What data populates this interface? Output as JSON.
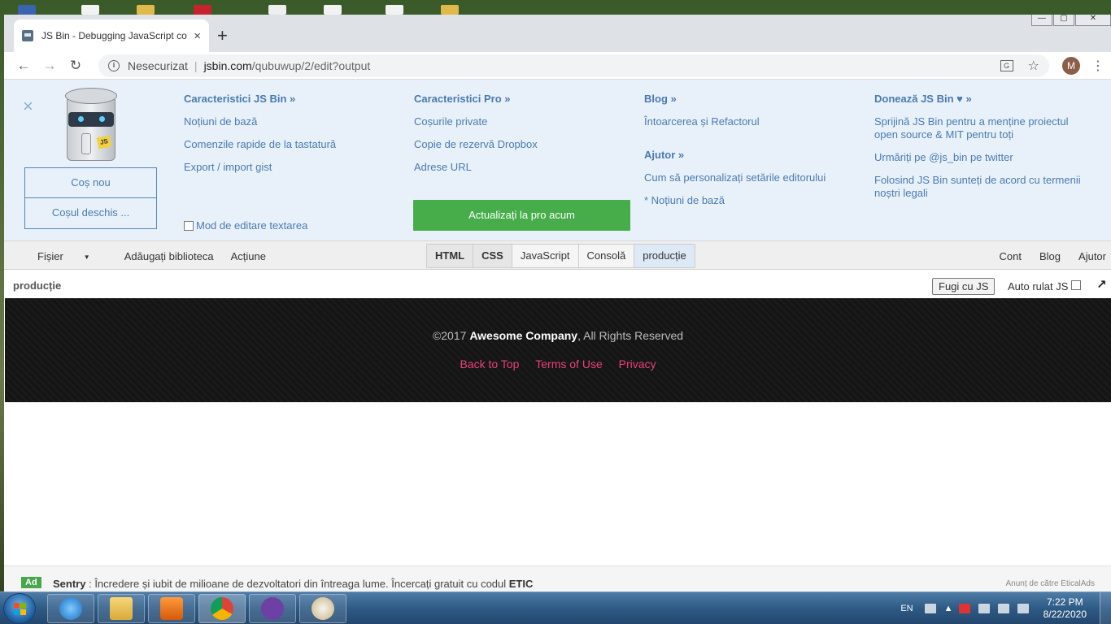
{
  "browser": {
    "tab_title": "JS Bin - Debugging JavaScript co",
    "tab_close": "×",
    "new_tab": "+",
    "security": "Nesecurizat",
    "url_host": "jsbin.com",
    "url_path": "/qubuwup/2/edit?output",
    "avatar_letter": "M",
    "window_controls": {
      "minimize": "—",
      "maximize": "▢",
      "close": "✕"
    }
  },
  "panel": {
    "close": "×",
    "logo_tag": "JS",
    "buttons": {
      "new_bin": "Coș nou",
      "open_bin": "Coșul deschis ..."
    },
    "col1": {
      "heading": "Caracteristici JS Bin »",
      "links": [
        "Noțiuni de bază",
        "Comenzile rapide de la tastatură",
        "Export / import gist"
      ]
    },
    "col2": {
      "heading": "Caracteristici Pro »",
      "links": [
        "Coșurile private",
        "Copie de rezervă Dropbox",
        "Adrese URL"
      ]
    },
    "col3": {
      "heading": "Blog »",
      "links": [
        "Întoarcerea și Refactorul"
      ],
      "heading2": "Ajutor »",
      "links2": [
        "Cum să personalizați setările editorului",
        "* Noțiuni de bază"
      ]
    },
    "col4": {
      "heading": "Donează JS Bin ♥ »",
      "links": [
        "Sprijină JS Bin pentru a menține proiectul open source & MIT pentru toți",
        "Urmăriți pe @js_bin pe twitter",
        "Folosind JS Bin sunteți de acord cu termenii noștri legali"
      ]
    },
    "textarea_mode": "Mod de editare textarea",
    "upgrade": "Actualizați la pro acum"
  },
  "jsbar": {
    "left_menu": [
      "Fișier",
      "Adăugați biblioteca",
      "Acțiune"
    ],
    "panels": [
      "HTML",
      "CSS",
      "JavaScript",
      "Consolă",
      "producție"
    ],
    "right_menu": [
      "Cont",
      "Blog",
      "Ajutor"
    ]
  },
  "output_header": {
    "label": "producție",
    "run": "Fugi cu JS",
    "auto_run": "Auto rulat JS",
    "popout": "↗"
  },
  "output": {
    "copyright_pre": "©2017 ",
    "company": "Awesome Company",
    "copyright_post": ", All Rights Reserved",
    "links": [
      "Back to Top",
      "Terms of Use",
      "Privacy"
    ]
  },
  "ad": {
    "badge": "Ad",
    "brand": "Sentry",
    "text": ": Încredere și iubit de milioane de dezvoltatori din întreaga lume. Încercați gratuit cu codul ",
    "code": "ETIC",
    "by": "Anunț de către EticalAds"
  },
  "taskbar": {
    "lang": "EN",
    "time": "7:22 PM",
    "date": "8/22/2020"
  },
  "colors": {
    "link_blue": "#4a7ab0",
    "upgrade_green": "#47ad4b",
    "footer_link_pink": "#e8417a",
    "panel_bg": "#e8f1fa"
  }
}
